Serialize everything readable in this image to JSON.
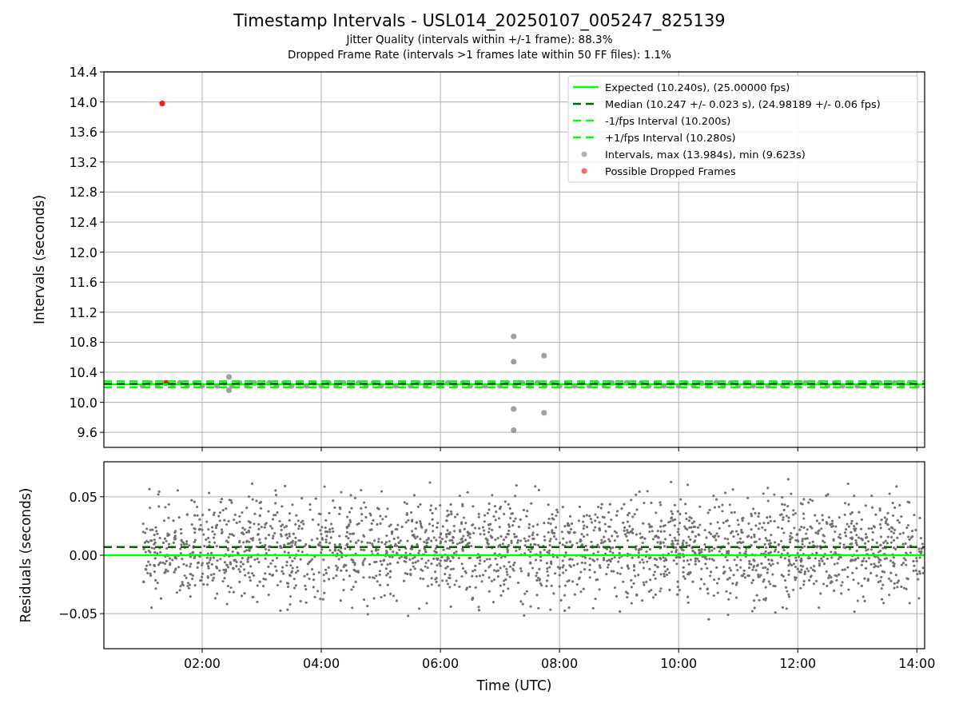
{
  "figure": {
    "title": "Timestamp Intervals - USL014_20250107_005247_825139",
    "subtitle_lines": [
      "Jitter Quality (intervals within +/-1 frame): 88.3%",
      "Dropped Frame Rate (intervals >1 frames late within 50 FF files): 1.1%"
    ]
  },
  "intervals_plot": {
    "chart_data": {
      "type": "scatter",
      "ylabel": "Intervals (seconds)",
      "xlim": [
        0.35,
        14.13
      ],
      "ylim": [
        9.4,
        14.4
      ],
      "grid": true,
      "legend": true,
      "yticks": [
        {
          "value": 9.6,
          "label": "9.6"
        },
        {
          "value": 10.0,
          "label": "10.0"
        },
        {
          "value": 10.4,
          "label": "10.4"
        },
        {
          "value": 10.8,
          "label": "10.8"
        },
        {
          "value": 11.2,
          "label": "11.2"
        },
        {
          "value": 11.6,
          "label": "11.6"
        },
        {
          "value": 12.0,
          "label": "12.0"
        },
        {
          "value": 12.4,
          "label": "12.4"
        },
        {
          "value": 12.8,
          "label": "12.8"
        },
        {
          "value": 13.2,
          "label": "13.2"
        },
        {
          "value": 13.6,
          "label": "13.6"
        },
        {
          "value": 14.0,
          "label": "14.0"
        },
        {
          "value": 14.4,
          "label": "14.4"
        }
      ],
      "ref_lines": [
        {
          "axis": "y",
          "value": 10.24,
          "label": "Expected (10.240s), (25.00000 fps)",
          "color": "#00ff00"
        },
        {
          "axis": "y",
          "value": 10.247,
          "label": "Median (10.247 +/- 0.023 s), (24.98189 +/- 0.06 fps)",
          "color": "#006400"
        },
        {
          "axis": "y",
          "value": 10.2,
          "label": "-1/fps Interval (10.200s)",
          "color": "#00ff00"
        },
        {
          "axis": "y",
          "value": 10.28,
          "label": "+1/fps Interval (10.280s)",
          "color": "#00ff00"
        }
      ],
      "series": [
        {
          "name": "Intervals, max (13.984s), min (9.623s)",
          "color": "#808080",
          "x": [
            1.0,
            1.125,
            1.25,
            1.375,
            1.5,
            1.625,
            1.75,
            1.875,
            2.0,
            2.125,
            2.25,
            2.375,
            2.5,
            2.625,
            2.75,
            2.875,
            3.0,
            3.125,
            3.25,
            3.375,
            3.5,
            3.625,
            3.75,
            3.875,
            4.0,
            4.125,
            4.25,
            4.375,
            4.5,
            4.625,
            4.75,
            4.875,
            5.0,
            5.125,
            5.25,
            5.375,
            5.5,
            5.625,
            5.75,
            5.875,
            6.0,
            6.125,
            6.25,
            6.375,
            6.5,
            6.625,
            6.75,
            6.875,
            7.0,
            7.125,
            7.25,
            7.375,
            7.5,
            7.625,
            7.75,
            7.875,
            8.0,
            8.125,
            8.25,
            8.375,
            8.5,
            8.625,
            8.75,
            8.875,
            9.0,
            9.125,
            9.25,
            9.375,
            9.5,
            9.625,
            9.75,
            9.875,
            10.0,
            10.125,
            10.25,
            10.375,
            10.5,
            10.625,
            10.75,
            10.875,
            11.0,
            11.125,
            11.25,
            11.375,
            11.5,
            11.625,
            11.75,
            11.875,
            12.0,
            12.125,
            12.25,
            12.375,
            12.5,
            12.625,
            12.75,
            12.875,
            13.0,
            13.125,
            13.25,
            13.375,
            13.5,
            13.625,
            13.75,
            13.875,
            14.0,
            7.23,
            7.23,
            7.23,
            7.23,
            7.74,
            7.74,
            2.45,
            2.45
          ],
          "values": [
            10.22,
            10.26,
            10.22,
            10.26,
            10.22,
            10.26,
            10.22,
            10.26,
            10.22,
            10.26,
            10.22,
            10.26,
            10.22,
            10.26,
            10.22,
            10.26,
            10.22,
            10.26,
            10.22,
            10.26,
            10.22,
            10.26,
            10.22,
            10.26,
            10.22,
            10.26,
            10.22,
            10.26,
            10.22,
            10.26,
            10.22,
            10.26,
            10.22,
            10.26,
            10.22,
            10.26,
            10.22,
            10.26,
            10.22,
            10.26,
            10.22,
            10.26,
            10.22,
            10.26,
            10.22,
            10.26,
            10.22,
            10.26,
            10.22,
            10.26,
            10.22,
            10.26,
            10.22,
            10.26,
            10.22,
            10.26,
            10.22,
            10.26,
            10.22,
            10.26,
            10.22,
            10.26,
            10.22,
            10.26,
            10.22,
            10.26,
            10.22,
            10.26,
            10.22,
            10.26,
            10.22,
            10.26,
            10.22,
            10.26,
            10.22,
            10.26,
            10.22,
            10.26,
            10.22,
            10.26,
            10.22,
            10.26,
            10.22,
            10.26,
            10.22,
            10.26,
            10.22,
            10.26,
            10.22,
            10.26,
            10.22,
            10.26,
            10.22,
            10.26,
            10.22,
            10.26,
            10.22,
            10.26,
            10.22,
            10.26,
            10.22,
            10.26,
            10.22,
            10.26,
            10.22,
            10.88,
            10.54,
            9.91,
            9.63,
            10.62,
            9.86,
            10.34,
            10.16
          ]
        },
        {
          "name": "Possible Dropped Frames",
          "color": "#ff0000",
          "x": [
            1.33,
            1.4
          ],
          "values": [
            13.98,
            10.26
          ]
        }
      ]
    }
  },
  "residuals_plot": {
    "chart_data": {
      "type": "scatter",
      "xlabel": "Time (UTC)",
      "ylabel": "Residuals (seconds)",
      "xlim": [
        0.35,
        14.13
      ],
      "ylim": [
        -0.08,
        0.08
      ],
      "grid": true,
      "xticks": [
        {
          "value": 2,
          "label": "02:00"
        },
        {
          "value": 4,
          "label": "04:00"
        },
        {
          "value": 6,
          "label": "06:00"
        },
        {
          "value": 8,
          "label": "08:00"
        },
        {
          "value": 10,
          "label": "10:00"
        },
        {
          "value": 12,
          "label": "12:00"
        },
        {
          "value": 14,
          "label": "14:00"
        }
      ],
      "yticks": [
        {
          "value": 0.05,
          "label": "0.05"
        },
        {
          "value": 0,
          "label": "0.00"
        },
        {
          "value": -0.05,
          "label": "−0.05"
        }
      ],
      "ref_lines": [
        {
          "axis": "y",
          "value": 0,
          "color": "#00ff00"
        },
        {
          "axis": "y",
          "value": 0.007,
          "color": "#006400"
        }
      ]
    }
  }
}
